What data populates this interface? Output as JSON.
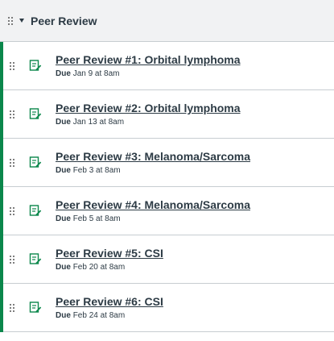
{
  "module": {
    "title": "Peer Review",
    "items": [
      {
        "title": "Peer Review #1: Orbital lymphoma",
        "due_label": "Due",
        "due_date": "Jan 9 at 8am"
      },
      {
        "title": "Peer Review #2: Orbital lymphoma",
        "due_label": "Due",
        "due_date": "Jan 13 at 8am"
      },
      {
        "title": "Peer Review #3: Melanoma/Sarcoma",
        "due_label": "Due",
        "due_date": "Feb 3 at 8am"
      },
      {
        "title": "Peer Review #4: Melanoma/Sarcoma",
        "due_label": "Due",
        "due_date": "Feb 5 at 8am"
      },
      {
        "title": "Peer Review #5: CSI",
        "due_label": "Due",
        "due_date": "Feb 20 at 8am"
      },
      {
        "title": "Peer Review #6: CSI",
        "due_label": "Due",
        "due_date": "Feb 24 at 8am"
      }
    ]
  },
  "icons": {
    "drag": "drag-handle-icon",
    "caret": "caret-down-icon",
    "assignment": "assignment-icon"
  },
  "colors": {
    "published_bar": "#0b874b",
    "assignment_icon": "#0b874b",
    "header_bg": "#f1f2f3",
    "text": "#2d3b45"
  }
}
